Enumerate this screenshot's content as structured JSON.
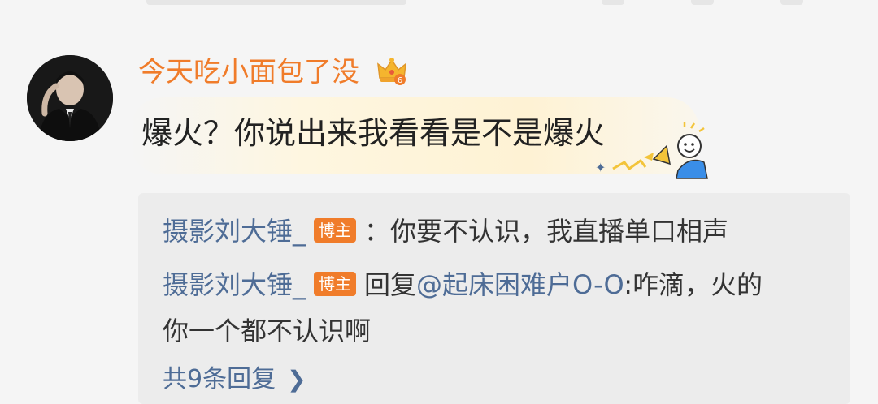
{
  "comment": {
    "username": "今天吃小面包了没",
    "text": "爆火？你说出来我看看是不是爆火"
  },
  "replies": [
    {
      "author": "摄影刘大锤_",
      "badge": "博主",
      "separator": "：",
      "text": "你要不认识，我直播单口相声"
    },
    {
      "author": "摄影刘大锤_",
      "badge": "博主",
      "reply_prefix": "回复",
      "mention": "@起床困难户O-O",
      "text": ":咋滴，火的",
      "text_cont": "你一个都不认识啊"
    }
  ],
  "more_replies": "共9条回复",
  "icons": {
    "crown": "crown-vip-icon",
    "chevron": "chevron-right-icon",
    "avatar": "user-avatar",
    "sticker": "megaphone-sticker"
  },
  "colors": {
    "username": "#f07c2a",
    "link": "#4e6c96",
    "badge": "#f07c2a",
    "reply_bg": "#ececec"
  }
}
